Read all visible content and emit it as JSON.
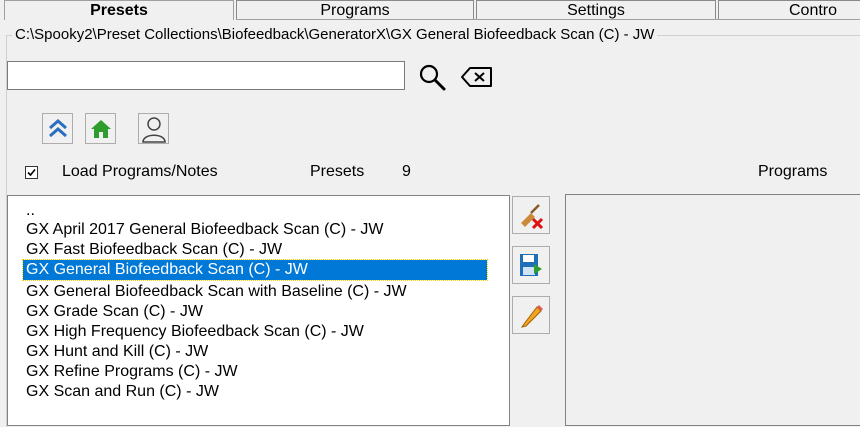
{
  "tabs": [
    {
      "label": "Presets",
      "active": true
    },
    {
      "label": "Programs",
      "active": false
    },
    {
      "label": "Settings",
      "active": false
    },
    {
      "label": "Contro",
      "active": false
    }
  ],
  "path": "C:\\Spooky2\\Preset Collections\\Biofeedback\\GeneratorX\\GX General Biofeedback Scan (C) - JW",
  "search": {
    "value": "",
    "placeholder": ""
  },
  "icons": {
    "search": "magnifier-icon",
    "clear": "backspace-icon",
    "up": "double-chevron-up-icon",
    "home": "home-icon",
    "user": "user-icon",
    "delete": "broom-delete-icon",
    "save": "save-icon",
    "edit": "pencil-icon"
  },
  "load_notes": {
    "label": "Load Programs/Notes",
    "checked": true
  },
  "presets_label": "Presets",
  "presets_count": "9",
  "programs_label": "Programs",
  "presets": [
    "..",
    "GX April 2017 General Biofeedback Scan (C) - JW",
    "GX Fast Biofeedback Scan (C) - JW",
    "GX General Biofeedback Scan (C) - JW",
    "GX General Biofeedback Scan with Baseline (C) - JW",
    "GX Grade Scan (C) - JW",
    "GX High Frequency Biofeedback Scan (C) - JW",
    "GX Hunt and Kill (C) - JW",
    "GX Refine Programs (C) - JW",
    "GX Scan and Run (C) - JW"
  ],
  "selected_preset_index": 3,
  "colors": {
    "selection": "#0078d7",
    "home_green": "#2e9d2e",
    "up_blue": "#2a6fbf"
  }
}
